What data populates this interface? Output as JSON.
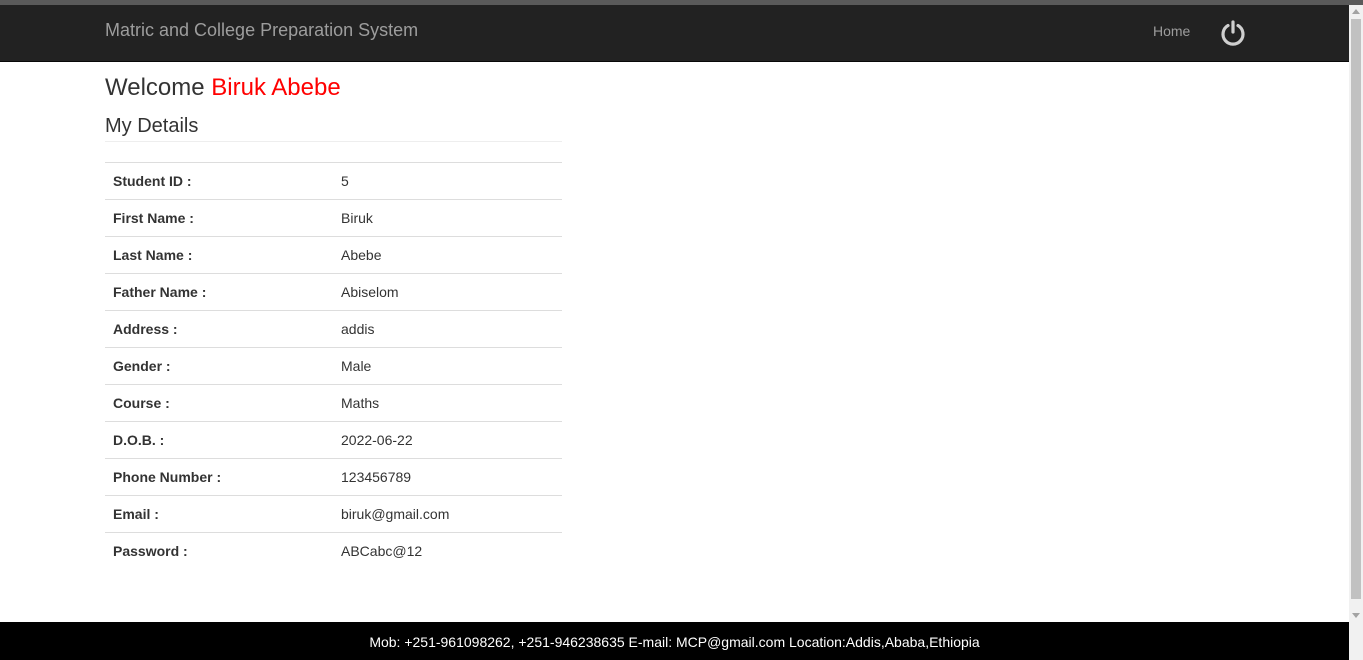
{
  "navbar": {
    "brand": "Matric and College Preparation System",
    "home_label": "Home",
    "power_icon": "power-icon"
  },
  "welcome": {
    "prefix": "Welcome",
    "name": "Biruk Abebe"
  },
  "section_title": "My Details",
  "details": [
    {
      "label": "Student ID :",
      "value": "5"
    },
    {
      "label": "First Name :",
      "value": "Biruk"
    },
    {
      "label": "Last Name :",
      "value": "Abebe"
    },
    {
      "label": "Father Name :",
      "value": "Abiselom"
    },
    {
      "label": "Address :",
      "value": "addis"
    },
    {
      "label": "Gender :",
      "value": "Male"
    },
    {
      "label": "Course :",
      "value": "Maths"
    },
    {
      "label": "D.O.B. :",
      "value": "2022-06-22"
    },
    {
      "label": "Phone Number :",
      "value": "123456789"
    },
    {
      "label": "Email :",
      "value": "biruk@gmail.com"
    },
    {
      "label": "Password :",
      "value": "ABCabc@12"
    }
  ],
  "footer": {
    "text": "Mob: +251-961098262, +251-946238635 E-mail: MCP@gmail.com Location:Addis,Ababa,Ethiopia"
  },
  "colors": {
    "navbar_bg": "#222222",
    "brand_text": "#9d9d9d",
    "welcome_name": "#ff0000",
    "footer_bg": "#000000"
  }
}
